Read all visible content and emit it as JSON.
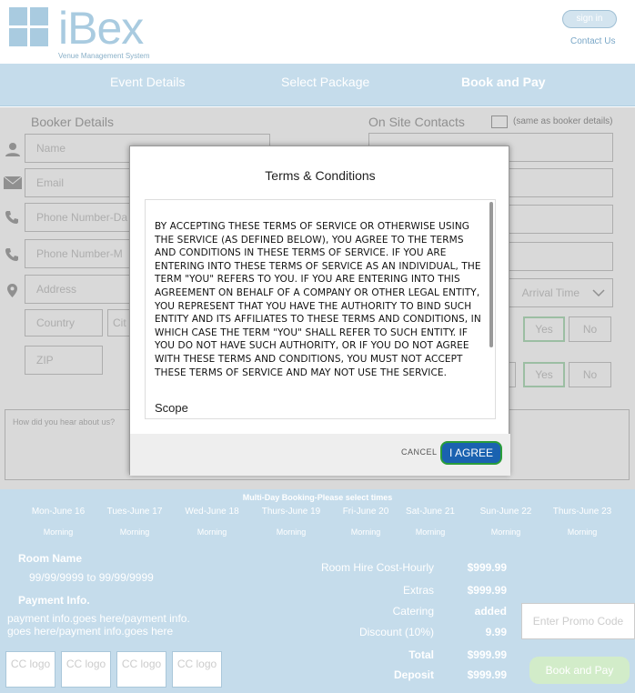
{
  "header": {
    "brand": "iBex",
    "tagline": "Venue Management System",
    "signin_label": "sign in",
    "contact_label": "Contact Us"
  },
  "nav": {
    "steps": [
      "Event Details",
      "Select Package",
      "Book and Pay"
    ]
  },
  "booker": {
    "title": "Booker Details",
    "name_placeholder": "Name",
    "email_placeholder": "Email",
    "phone_day_placeholder": "Phone Number-Da",
    "phone_mobile_placeholder": "Phone Number-M",
    "address_placeholder": "Address",
    "country_placeholder": "Country",
    "city_placeholder": "Cit",
    "zip_placeholder": "ZIP"
  },
  "onsite": {
    "title": "On Site Contacts",
    "same_label": "(same as booker details)",
    "arrival_placeholder": "Arrival Time",
    "yes_label": "Yes",
    "no_label": "No"
  },
  "hear_placeholder": "How did you hear about us?",
  "modal": {
    "title": "Terms & Conditions",
    "body": "BY ACCEPTING THESE TERMS OF SERVICE OR OTHERWISE USING THE SERVICE (AS DEFINED BELOW), YOU AGREE TO THE TERMS AND CONDITIONS IN THESE TERMS OF SERVICE. IF YOU ARE ENTERING INTO THESE TERMS OF SERVICE AS AN INDIVIDUAL, THE TERM \"YOU\" REFERS TO YOU. IF YOU ARE ENTERING INTO THIS AGREEMENT ON BEHALF OF A COMPANY OR OTHER LEGAL ENTITY, YOU REPRESENT THAT YOU HAVE THE AUTHORITY TO BIND SUCH ENTITY AND ITS AFFILIATES TO THESE TERMS AND CONDITIONS, IN WHICH CASE THE TERM \"YOU\" SHALL REFER TO SUCH ENTITY. IF YOU DO NOT HAVE SUCH AUTHORITY, OR IF YOU DO NOT AGREE WITH THESE TERMS AND CONDITIONS, YOU MUST NOT ACCEPT THESE TERMS OF SERVICE AND MAY NOT USE THE SERVICE.",
    "scope_heading": "Scope",
    "cancel_label": "CANCEL",
    "agree_label": "I AGREE"
  },
  "booking": {
    "title": "Multi-Day Booking-Please select times",
    "days": [
      "Mon-June 16",
      "Tues-June 17",
      "Wed-June 18",
      "Thurs-June 19",
      "Fri-June 20",
      "Sat-June 21",
      "Sun-June 22",
      "Thurs-June 23"
    ],
    "slot_label": "Morning"
  },
  "room": {
    "label": "Room Name",
    "dates": "99/99/9999 to 99/99/9999"
  },
  "payment": {
    "label": "Payment Info.",
    "text": "payment info.goes here/payment info. goes here/payment info.goes here",
    "cc_label": "CC logo"
  },
  "costs": [
    {
      "label": "Room Hire Cost-Hourly",
      "value": "$999.99"
    },
    {
      "label": "Extras",
      "value": "$999.99"
    },
    {
      "label": "Catering",
      "value": "added"
    },
    {
      "label": "Discount (10%)",
      "value": "9.99"
    },
    {
      "label": "Total",
      "value": "$999.99"
    },
    {
      "label": "Deposit",
      "value": "$999.99"
    }
  ],
  "promo_placeholder": "Enter Promo Code",
  "book_pay_label": "Book and Pay",
  "colors": {
    "accent": "#c5dceb",
    "agree": "#1a62b0",
    "agree_border": "#2a9d3a"
  }
}
